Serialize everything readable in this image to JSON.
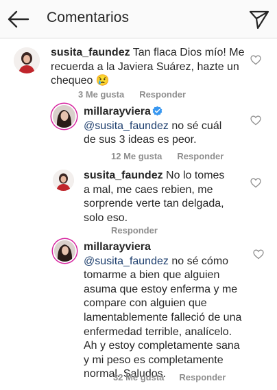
{
  "header": {
    "title": "Comentarios",
    "back_icon": "arrow-left-icon",
    "share_icon": "send-direct-icon"
  },
  "comments": [
    {
      "username": "susita_faundez",
      "text": "Tan flaca Dios mío! Me recuerda a la Javiera Suárez, hazte un chequeo 😢",
      "likes": "3 Me gusta",
      "reply": "Responder"
    },
    {
      "username": "millarayviera",
      "verified": true,
      "mention": "@susita_faundez",
      "text": "no sé cuál de sus 3 ideas es peor.",
      "likes": "12 Me gusta",
      "reply": "Responder"
    },
    {
      "username": "susita_faundez",
      "text": "No lo tomes a mal, me caes rebien, me sorprende verte tan delgada, solo eso.",
      "reply": "Responder"
    },
    {
      "username": "millarayviera",
      "mention": "@susita_faundez",
      "text": "no sé cómo tomarme a bien que alguien asuma que estoy enferma y me compare con alguien que lamentablemente falleció de una enfermedad terrible, analícelo. Ah y estoy completamente sana y mi peso es completamente normal. Saludos.",
      "likes": "32 Me gusta",
      "reply": "Responder"
    }
  ],
  "colors": {
    "text": "#262626",
    "meta": "#8e8e8e",
    "mention": "#1e3f6e",
    "verified": "#3897f0"
  }
}
